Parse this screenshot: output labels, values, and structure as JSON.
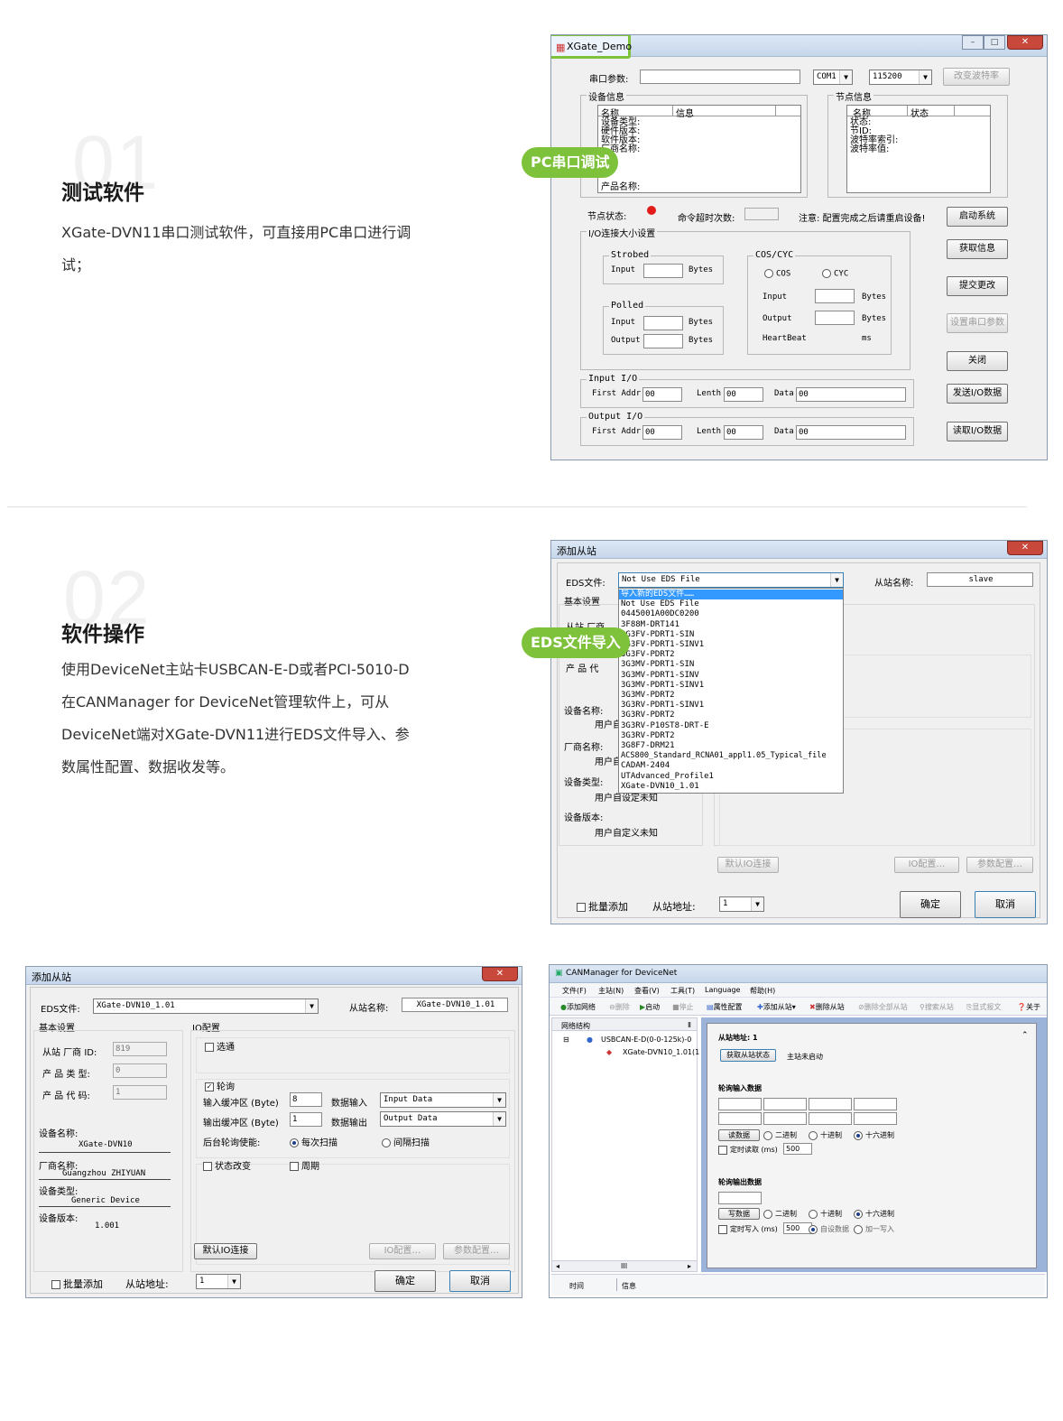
{
  "sec1": {
    "num": "01",
    "title": "测试软件",
    "desc": "XGate-DVN11串口测试软件，可直接用PC串口进行调试；",
    "tag": "PC串口调试"
  },
  "sec2": {
    "num": "02",
    "title": "软件操作",
    "desc": "使用DeviceNet主站卡USBCAN-E-D或者PCI-5010-D在CANManager for DeviceNet管理软件上，可从DeviceNet端对XGate-DVN11进行EDS文件导入、参数属性配置、数据收发等。",
    "tag": "EDS文件导入"
  },
  "colors": {
    "accent": "#7ec13b"
  },
  "w1": {
    "title": "XGate_Demo",
    "port_label": "串口参数:",
    "com": "COM1",
    "baud": "115200",
    "change_baud": "改变波特率",
    "devinfo_label": "设备信息",
    "devinfo_cols": [
      "名称",
      "信息"
    ],
    "devinfo_rows": [
      "设备类型:",
      "硬件版本:",
      "软件版本:",
      "厂商名称:",
      "产品名称:"
    ],
    "nodeinfo_label": "节点信息",
    "nodeinfo_cols": [
      "名称",
      "状态"
    ],
    "nodeinfo_rows": [
      "状态:",
      "节ID:",
      "波特率索引:",
      "波特率值:"
    ],
    "node_state": "节点状态:",
    "cmd_timeout": "命令超时次数:",
    "note": "注意: 配置完成之后请重启设备!",
    "io_label": "I/O连接大小设置",
    "strobed": "Strobed",
    "polled": "Polled",
    "coscyc": "COS/CYC",
    "cos": "COS",
    "cyc": "CYC",
    "input": "Input",
    "output": "Output",
    "bytes": "Bytes",
    "heartbeat": "HeartBeat",
    "ms": "ms",
    "input_io": "Input I/O",
    "output_io": "Output I/O",
    "first_addr": "First Addr",
    "lenth": "Lenth",
    "data": "Data",
    "zero": "00",
    "buttons": [
      "启动系统",
      "获取信息",
      "提交更改",
      "设置串口参数",
      "关闭",
      "发送I/O数据",
      "读取I/O数据"
    ]
  },
  "w2": {
    "title": "添加从站",
    "eds_label": "EDS文件:",
    "eds_value": "Not Use EDS File",
    "slave_name_label": "从站名称:",
    "slave_name": "slave",
    "basic": "基本设置",
    "vendor": "从站 厂商",
    "product": "产 品 代",
    "dev_name": "设备名称:",
    "vendor_name": "厂商名称:",
    "dev_type": "设备类型:",
    "dev_ver": "设备版本:",
    "user_undef": "用户自定义",
    "user_undef2": "用户自定义未知",
    "user_undef3": "用户自设定未知",
    "dropdown": [
      "导入新的EDS文件……",
      "Not Use EDS File",
      "0445001A00DC0200",
      "3F88M-DRT141",
      "3G3FV-PDRT1-SIN",
      "3G3FV-PDRT1-SINV1",
      "3G3FV-PDRT2",
      "3G3MV-PDRT1-SIN",
      "3G3MV-PDRT1-SINV",
      "3G3MV-PDRT1-SINV1",
      "3G3MV-PDRT2",
      "3G3RV-PDRT1-SINV1",
      "3G3RV-PDRT2",
      "3G3RV-P10ST8-DRT-E",
      "3G3RV-PDRT2",
      "3G8F7-DRM21",
      "ACS800_Standard_RCNA01_appl1.05_Typical_file",
      "CADAM-2404",
      "UTAdvanced_Profile1",
      "XGate-DVN10_1.01"
    ],
    "default_io": "默认IO连接",
    "io_conf": "IO配置…",
    "param_conf": "参数配置…",
    "batch": "批量添加",
    "addr_label": "从站地址:",
    "addr": "1",
    "ok": "确定",
    "cancel": "取消"
  },
  "w3": {
    "title": "添加从站",
    "eds_label": "EDS文件:",
    "eds_value": "XGate-DVN10_1.01",
    "slave_name_label": "从站名称:",
    "slave_name": "XGate-DVN10_1.01",
    "basic": "基本设置",
    "vendor_id_label": "从站 厂商 ID:",
    "vendor_id": "819",
    "type_label": "产 品 类 型:",
    "type": "0",
    "code_label": "产 品 代 码:",
    "code": "1",
    "dev_name_label": "设备名称:",
    "dev_name": "XGate-DVN10",
    "vendor_name_label": "厂商名称:",
    "vendor_name": "Guangzhou ZHIYUAN",
    "dev_type_label": "设备类型:",
    "dev_type": "Generic Device",
    "dev_ver_label": "设备版本:",
    "dev_ver": "1.001",
    "io_conf_label": "IO配置",
    "strobe": "选通",
    "poll": "轮询",
    "in_buf": "输入缓冲区 (Byte)",
    "in_buf_val": "8",
    "out_buf": "输出缓冲区 (Byte)",
    "out_buf_val": "1",
    "data_in": "数据输入",
    "data_in_val": "Input Data",
    "data_out": "数据输出",
    "data_out_val": "Output Data",
    "bg_poll": "后台轮询使能:",
    "every": "每次扫描",
    "interval": "间隔扫描",
    "cos": "状态改变",
    "cyclic": "周期",
    "default_io": "默认IO连接",
    "io_conf": "IO配置…",
    "param_conf": "参数配置…",
    "batch": "批量添加",
    "addr_label": "从站地址:",
    "addr": "1",
    "ok": "确定",
    "cancel": "取消"
  },
  "w4": {
    "title": "CANManager for DeviceNet",
    "menu": [
      "文件(F)",
      "主站(N)",
      "查看(V)",
      "工具(T)",
      "Language",
      "帮助(H)"
    ],
    "toolbar": [
      "添加网络",
      "删除",
      "启动",
      "停止",
      "属性配置",
      "添加从站",
      "删除从站",
      "删除全部从站",
      "搜索从站",
      "显式报文",
      "关于"
    ],
    "tree_title": "网络结构",
    "tree_pin": "Ⅱ",
    "tree_node1": "USBCAN-E-D(0-0-125k)-0",
    "tree_node2": "XGate-DVN10_1.01(1",
    "slave_addr": "从站地址: 1",
    "get_state": "获取从站状态",
    "not_started": "主站未启动",
    "poll_in": "轮询输入数据",
    "read_btn": "读数据",
    "bin": "二进制",
    "dec": "十进制",
    "hex": "十六进制",
    "timed_read": "定时读取 (ms)",
    "ms500": "500",
    "poll_out": "轮询输出数据",
    "write_btn": "写数据",
    "timed_write": "定时写入 (ms)",
    "auto_data": "自设数据",
    "add_one": "加一写入",
    "log_time": "时间",
    "log_info": "信息",
    "scroll_mark": "III"
  }
}
